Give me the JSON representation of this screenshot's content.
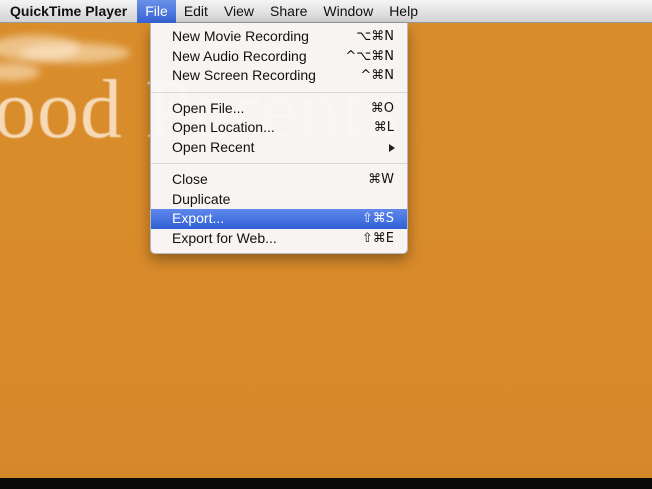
{
  "menubar": {
    "app_name": "QuickTime Player",
    "items": [
      {
        "label": "File",
        "active": true
      },
      {
        "label": "Edit"
      },
      {
        "label": "View"
      },
      {
        "label": "Share"
      },
      {
        "label": "Window"
      },
      {
        "label": "Help"
      }
    ]
  },
  "background": {
    "title_text": "ood Parents"
  },
  "file_menu": {
    "groups": [
      [
        {
          "label": "New Movie Recording",
          "shortcut": "⌥⌘N"
        },
        {
          "label": "New Audio Recording",
          "shortcut": "^⌥⌘N"
        },
        {
          "label": "New Screen Recording",
          "shortcut": "^⌘N"
        }
      ],
      [
        {
          "label": "Open File...",
          "shortcut": "⌘O"
        },
        {
          "label": "Open Location...",
          "shortcut": "⌘L"
        },
        {
          "label": "Open Recent",
          "submenu": true
        }
      ],
      [
        {
          "label": "Close",
          "shortcut": "⌘W"
        },
        {
          "label": "Duplicate",
          "shortcut": ""
        },
        {
          "label": "Export...",
          "shortcut": "⇧⌘S",
          "highlighted": true
        },
        {
          "label": "Export for Web...",
          "shortcut": "⇧⌘E"
        }
      ]
    ]
  },
  "colors": {
    "background": "#d88a2a",
    "menu_highlight": "#3563d6"
  }
}
